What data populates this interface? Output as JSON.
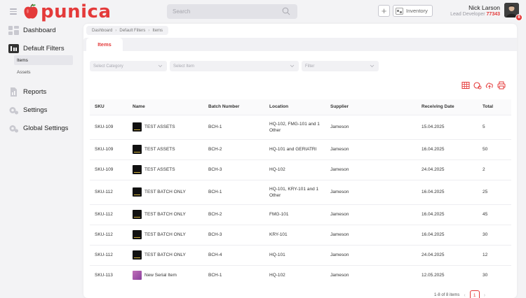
{
  "app": {
    "logo_text": "punica"
  },
  "header": {
    "search_placeholder": "Search",
    "inventory_label": "Inventory",
    "user_name": "Nick Larson",
    "user_role": "Lead Developer",
    "user_id": "77343",
    "notification_count": "8"
  },
  "sidebar": {
    "dashboard": "Dashboard",
    "default_filters": "Default Filters",
    "sub_items": [
      "Items",
      "Assets"
    ],
    "reports": "Reports",
    "settings": "Settings",
    "global_settings": "Global Settings"
  },
  "breadcrumb": [
    "Dashboard",
    "Default Filters",
    "Items"
  ],
  "tabs": [
    {
      "label": "Items",
      "active": true
    }
  ],
  "filters": {
    "category_placeholder": "Select Category",
    "item_placeholder": "Select Item",
    "filter_placeholder": "Filter"
  },
  "actions": [
    "table-grid-icon",
    "tag-icon",
    "cloud-upload-icon",
    "print-icon"
  ],
  "table": {
    "columns": [
      "SKU",
      "Name",
      "Batch Number",
      "Location",
      "Supplier",
      "Receiving Date",
      "Total"
    ],
    "rows": [
      {
        "sku": "SKU-109",
        "name": "TEST ASSETS",
        "thumb": "dark",
        "batch": "BCH-1",
        "location": "HQ-102, FMG-101 and 1 Other",
        "supplier": "Jameson",
        "date": "15.04.2025",
        "total": "5"
      },
      {
        "sku": "SKU-109",
        "name": "TEST ASSETS",
        "thumb": "dark",
        "batch": "BCH-2",
        "location": "HQ-101 and GERIATRI",
        "supplier": "Jameson",
        "date": "16.04.2025",
        "total": "50"
      },
      {
        "sku": "SKU-109",
        "name": "TEST ASSETS",
        "thumb": "dark",
        "batch": "BCH-3",
        "location": "HQ-102",
        "supplier": "Jameson",
        "date": "24.04.2025",
        "total": "2"
      },
      {
        "sku": "SKU-112",
        "name": "TEST BATCH ONLY",
        "thumb": "dark",
        "batch": "BCH-1",
        "location": "HQ-101, KRY-101 and 1 Other",
        "supplier": "Jameson",
        "date": "16.04.2025",
        "total": "25"
      },
      {
        "sku": "SKU-112",
        "name": "TEST BATCH ONLY",
        "thumb": "dark",
        "batch": "BCH-2",
        "location": "FMG-101",
        "supplier": "Jameson",
        "date": "16.04.2025",
        "total": "45"
      },
      {
        "sku": "SKU-112",
        "name": "TEST BATCH ONLY",
        "thumb": "dark",
        "batch": "BCH-3",
        "location": "KRY-101",
        "supplier": "Jameson",
        "date": "16.04.2025",
        "total": "30"
      },
      {
        "sku": "SKU-112",
        "name": "TEST BATCH ONLY",
        "thumb": "dark",
        "batch": "BCH-4",
        "location": "HQ-101",
        "supplier": "Jameson",
        "date": "24.04.2025",
        "total": "12"
      },
      {
        "sku": "SKU-113",
        "name": "New Serial Item",
        "thumb": "purple",
        "batch": "BCH-1",
        "location": "HQ-102",
        "supplier": "Jameson",
        "date": "12.05.2025",
        "total": "30"
      }
    ]
  },
  "pagination": {
    "summary": "1-8 of 8 items",
    "current_page": "1"
  },
  "colors": {
    "accent": "#e43a3a",
    "background": "#f3f3f5",
    "panel": "#ffffff"
  }
}
